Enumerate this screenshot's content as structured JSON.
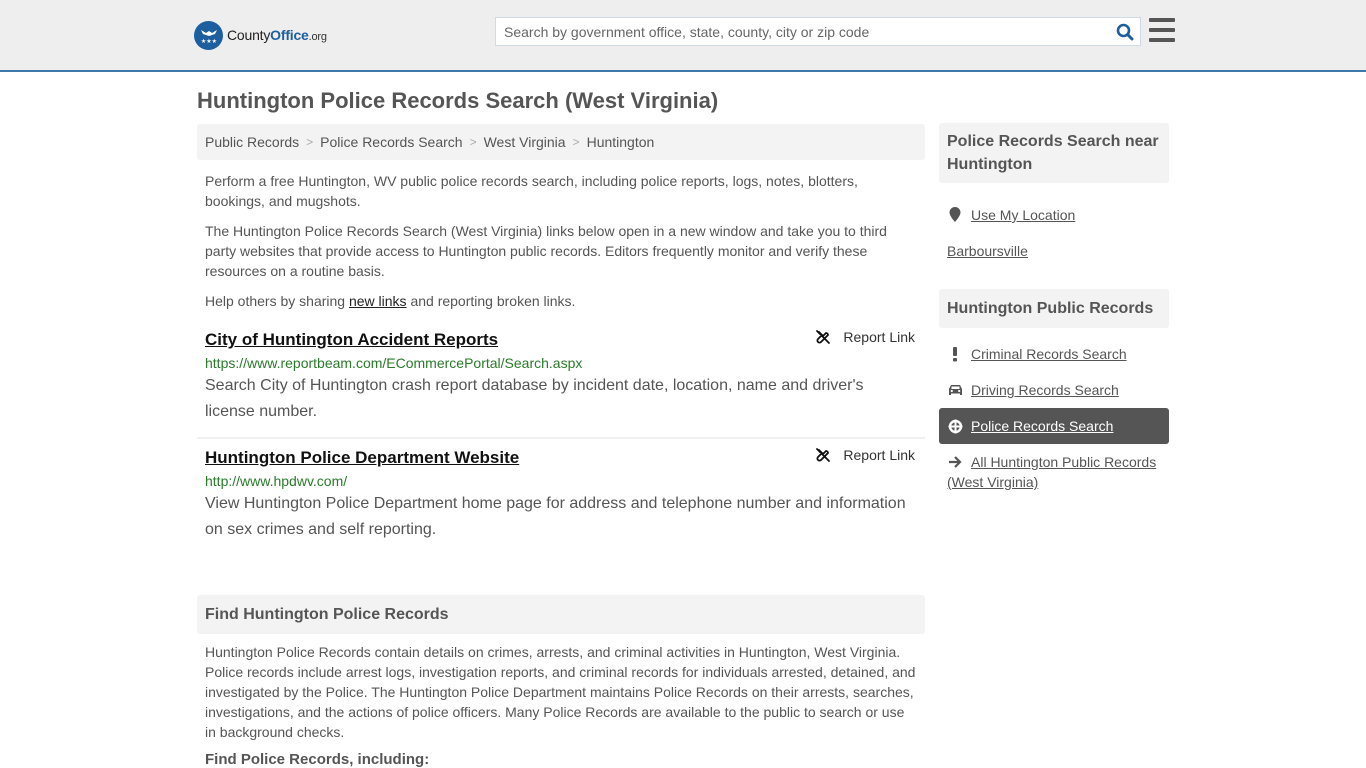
{
  "header": {
    "logo": {
      "name": "County",
      "name_accent": "Office",
      "tld": ".org"
    },
    "search": {
      "placeholder": "Search by government office, state, county, city or zip code",
      "value": ""
    },
    "icons": {
      "search": "search-icon",
      "menu": "hamburger-menu-icon"
    }
  },
  "page": {
    "title": "Huntington Police Records Search (West Virginia)"
  },
  "breadcrumb": [
    {
      "label": "Public Records"
    },
    {
      "label": "Police Records Search"
    },
    {
      "label": "West Virginia"
    },
    {
      "label": "Huntington"
    }
  ],
  "breadcrumb_separator": ">",
  "intro": {
    "p1": "Perform a free Huntington, WV public police records search, including police reports, logs, notes, blotters, bookings, and mugshots.",
    "p2": "The Huntington Police Records Search (West Virginia) links below open in a new window and take you to third party websites that provide access to Huntington public records. Editors frequently monitor and verify these resources on a routine basis.",
    "p3_before": "Help others by sharing ",
    "p3_link": "new links",
    "p3_after": " and reporting broken links."
  },
  "results": [
    {
      "title": "City of Huntington Accident Reports",
      "url": "https://www.reportbeam.com/ECommercePortal/Search.aspx",
      "description": "Search City of Huntington crash report database by incident date, location, name and driver's license number.",
      "report_label": "Report Link"
    },
    {
      "title": "Huntington Police Department Website",
      "url": "http://www.hpdwv.com/",
      "description": "View Huntington Police Department home page for address and telephone number and information on sex crimes and self reporting.",
      "report_label": "Report Link"
    }
  ],
  "find_section": {
    "heading": "Find Huntington Police Records",
    "body": "Huntington Police Records contain details on crimes, arrests, and criminal activities in Huntington, West Virginia. Police records include arrest logs, investigation reports, and criminal records for individuals arrested, detained, and investigated by the Police. The Huntington Police Department maintains Police Records on their arrests, searches, investigations, and the actions of police officers. Many Police Records are available to the public to search or use in background checks.",
    "subheading": "Find Police Records, including:"
  },
  "sidebar": {
    "near": {
      "heading": "Police Records Search near Huntington",
      "use_location": "Use My Location",
      "places": [
        "Barboursville"
      ]
    },
    "public_records": {
      "heading": "Huntington Public Records",
      "items": [
        {
          "label": "Criminal Records Search",
          "icon": "exclamation-icon",
          "active": false
        },
        {
          "label": "Driving Records Search",
          "icon": "car-icon",
          "active": false
        },
        {
          "label": "Police Records Search",
          "icon": "crosshair-icon",
          "active": true
        },
        {
          "label": "All Huntington Public Records (West Virginia)",
          "icon": "arrow-right-icon",
          "active": false
        }
      ]
    }
  },
  "colors": {
    "brand_blue": "#1d5e9f",
    "header_border": "#3d78ab",
    "url_green": "#2a7a2a",
    "active_item_bg": "#555555"
  }
}
